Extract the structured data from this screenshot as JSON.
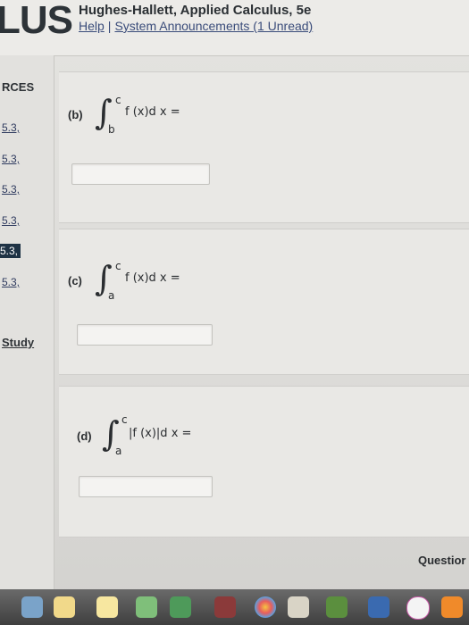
{
  "header": {
    "logo_fragment": "LUS",
    "book_title": "Hughes-Hallett, Applied Calculus, 5e",
    "help_link": "Help",
    "separator": "|",
    "announcements_link": "System Announcements (1 Unread)"
  },
  "sidebar": {
    "heading": "RCES",
    "items": [
      {
        "label": "5.3,"
      },
      {
        "label": "5.3,"
      },
      {
        "label": "5.3,"
      },
      {
        "label": "5.3,"
      },
      {
        "label": "5.3,"
      },
      {
        "label": "5.3,"
      }
    ],
    "study_link": "Study"
  },
  "questions": [
    {
      "part": "(b)",
      "upper": "c",
      "lower": "b",
      "expression": "f (x)d x ="
    },
    {
      "part": "(c)",
      "upper": "c",
      "lower": "a",
      "expression": "f (x)d x ="
    },
    {
      "part": "(d)",
      "upper": "c",
      "lower": "a",
      "expression": "|f (x)|d x ="
    }
  ],
  "footer": {
    "question_link": "Questior"
  },
  "dock": {
    "icons": [
      "preview-icon",
      "notes-icon",
      "maps-icon",
      "facetime-icon",
      "photo-booth-icon",
      "photos-icon",
      "maps-2-icon",
      "calendar-icon",
      "numbers-icon",
      "keynote-icon",
      "itunes-icon",
      "ibooks-icon"
    ]
  }
}
